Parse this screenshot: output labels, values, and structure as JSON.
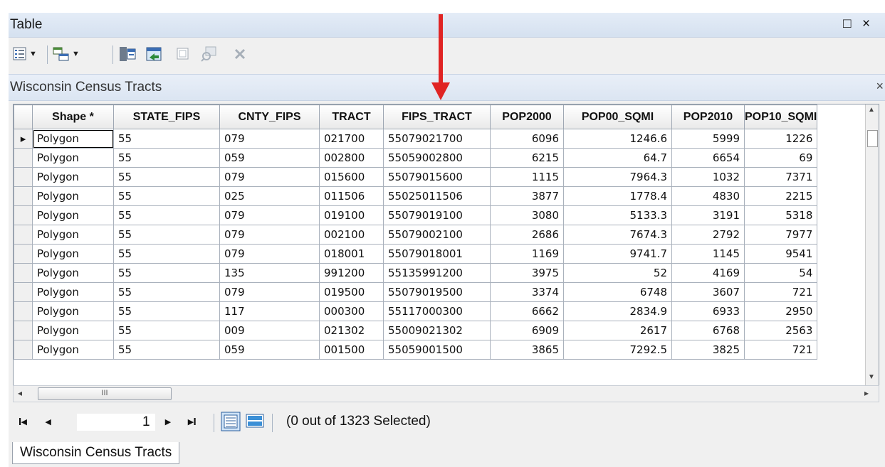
{
  "window": {
    "title": "Table",
    "restore_glyph": "□",
    "close_glyph": "×"
  },
  "toolbar": {
    "icons": [
      "table-options-icon",
      "related-tables-icon",
      "select-by-attributes-icon",
      "switch-selection-icon",
      "clear-selection-icon",
      "zoom-to-selected-icon",
      "delete-selected-icon"
    ]
  },
  "layer": {
    "title": "Wisconsin Census Tracts",
    "close_glyph": "×"
  },
  "grid": {
    "columns": [
      "Shape *",
      "STATE_FIPS",
      "CNTY_FIPS",
      "TRACT",
      "FIPS_TRACT",
      "POP2000",
      "POP00_SQMI",
      "POP2010",
      "POP10_SQMI"
    ],
    "rows": [
      [
        "Polygon",
        "55",
        "079",
        "021700",
        "55079021700",
        "6096",
        "1246.6",
        "5999",
        "1226"
      ],
      [
        "Polygon",
        "55",
        "059",
        "002800",
        "55059002800",
        "6215",
        "64.7",
        "6654",
        "69"
      ],
      [
        "Polygon",
        "55",
        "079",
        "015600",
        "55079015600",
        "1115",
        "7964.3",
        "1032",
        "7371"
      ],
      [
        "Polygon",
        "55",
        "025",
        "011506",
        "55025011506",
        "3877",
        "1778.4",
        "4830",
        "2215"
      ],
      [
        "Polygon",
        "55",
        "079",
        "019100",
        "55079019100",
        "3080",
        "5133.3",
        "3191",
        "5318"
      ],
      [
        "Polygon",
        "55",
        "079",
        "002100",
        "55079002100",
        "2686",
        "7674.3",
        "2792",
        "7977"
      ],
      [
        "Polygon",
        "55",
        "079",
        "018001",
        "55079018001",
        "1169",
        "9741.7",
        "1145",
        "9541"
      ],
      [
        "Polygon",
        "55",
        "135",
        "991200",
        "55135991200",
        "3975",
        "52",
        "4169",
        "54"
      ],
      [
        "Polygon",
        "55",
        "079",
        "019500",
        "55079019500",
        "3374",
        "6748",
        "3607",
        "721"
      ],
      [
        "Polygon",
        "55",
        "117",
        "000300",
        "55117000300",
        "6662",
        "2834.9",
        "6933",
        "2950"
      ],
      [
        "Polygon",
        "55",
        "009",
        "021302",
        "55009021302",
        "6909",
        "2617",
        "6768",
        "2563"
      ],
      [
        "Polygon",
        "55",
        "059",
        "001500",
        "55059001500",
        "3865",
        "7292.5",
        "3825",
        "721"
      ]
    ],
    "current_row_marker": "▸"
  },
  "hscroll": {
    "thumb_grip": "III"
  },
  "nav": {
    "first": "I◂",
    "prev": "◂",
    "page": "1",
    "next": "▸",
    "last": "▸I",
    "selection_status": "(0 out of 1323 Selected)"
  },
  "bottom_tab": {
    "label": "Wisconsin Census Tracts"
  },
  "colors": {
    "annotation_arrow": "#e02424",
    "titlebar": "#d5e1f0"
  }
}
